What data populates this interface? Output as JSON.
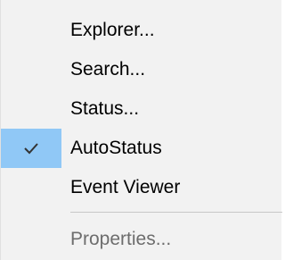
{
  "menu": {
    "items": [
      {
        "label": "Explorer...",
        "checked": false,
        "enabled": true
      },
      {
        "label": "Search...",
        "checked": false,
        "enabled": true
      },
      {
        "label": "Status...",
        "checked": false,
        "enabled": true
      },
      {
        "label": "AutoStatus",
        "checked": true,
        "enabled": true
      },
      {
        "label": "Event Viewer",
        "checked": false,
        "enabled": true
      },
      {
        "label": "Properties...",
        "checked": false,
        "enabled": false
      }
    ],
    "check_icon": "checkmark-icon",
    "colors": {
      "background": "#f2f2f2",
      "check_highlight": "#90c8f6",
      "disabled_text": "#6d6d6d",
      "separator": "#c8c8c8"
    }
  }
}
